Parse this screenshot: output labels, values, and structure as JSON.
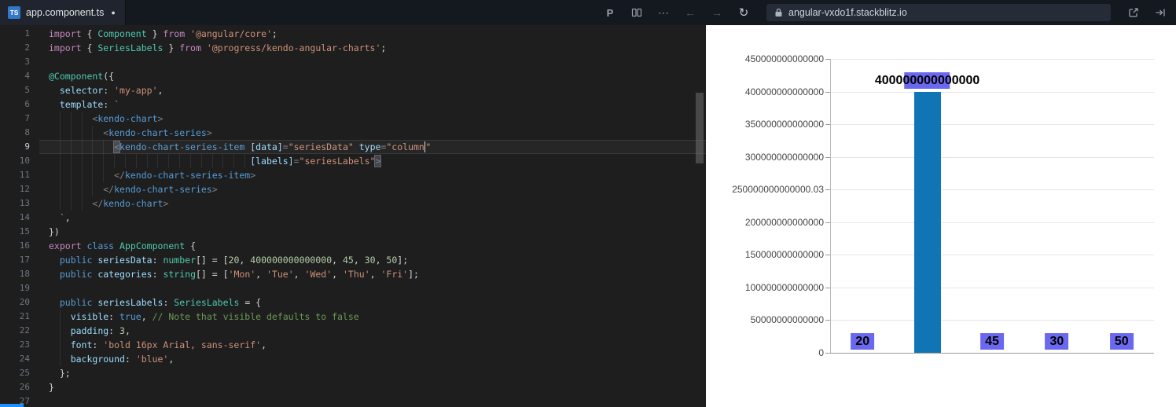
{
  "topbar": {
    "tab": {
      "icon_text": "TS",
      "label": "app.component.ts",
      "modified_dot": "●"
    },
    "actions": {
      "prettier": "P",
      "more": "⋯",
      "back": "←",
      "forward": "→",
      "refresh": "↻"
    },
    "url": "angular-vxdo1f.stackblitz.io"
  },
  "editor": {
    "active_line": 9,
    "lines": [
      {
        "n": 1,
        "segs": [
          [
            "kw",
            "import"
          ],
          [
            "d",
            " { "
          ],
          [
            "ty",
            "Component"
          ],
          [
            "d",
            " } "
          ],
          [
            "kw",
            "from"
          ],
          [
            "d",
            " "
          ],
          [
            "st",
            "'@angular/core'"
          ],
          [
            "d",
            ";"
          ]
        ]
      },
      {
        "n": 2,
        "segs": [
          [
            "kw",
            "import"
          ],
          [
            "d",
            " { "
          ],
          [
            "ty",
            "SeriesLabels"
          ],
          [
            "d",
            " } "
          ],
          [
            "kw",
            "from"
          ],
          [
            "d",
            " "
          ],
          [
            "st",
            "'@progress/kendo-angular-charts'"
          ],
          [
            "d",
            ";"
          ]
        ]
      },
      {
        "n": 3,
        "segs": []
      },
      {
        "n": 4,
        "segs": [
          [
            "ty",
            "@Component"
          ],
          [
            "d",
            "({"
          ]
        ]
      },
      {
        "n": 5,
        "segs": [
          [
            "d",
            "  "
          ],
          [
            "pr",
            "selector"
          ],
          [
            "d",
            ": "
          ],
          [
            "st",
            "'my-app'"
          ],
          [
            "d",
            ","
          ]
        ]
      },
      {
        "n": 6,
        "segs": [
          [
            "d",
            "  "
          ],
          [
            "pr",
            "template"
          ],
          [
            "d",
            ": "
          ],
          [
            "st",
            "`"
          ]
        ]
      },
      {
        "n": 7,
        "segs": [
          [
            "d",
            "        "
          ],
          [
            "pu",
            "<"
          ],
          [
            "tg",
            "kendo-chart"
          ],
          [
            "pu",
            ">"
          ]
        ]
      },
      {
        "n": 8,
        "segs": [
          [
            "d",
            "          "
          ],
          [
            "pu",
            "<"
          ],
          [
            "tg",
            "kendo-chart-series"
          ],
          [
            "pu",
            ">"
          ]
        ]
      },
      {
        "n": 9,
        "segs": [
          [
            "d",
            "            "
          ],
          [
            "pu bm",
            "<"
          ],
          [
            "tg",
            "kendo-chart-series-item"
          ],
          [
            "d",
            " "
          ],
          [
            "pr",
            "[data]"
          ],
          [
            "pu",
            "="
          ],
          [
            "st",
            "\"seriesData\""
          ],
          [
            "d",
            " "
          ],
          [
            "pr",
            "type"
          ],
          [
            "pu",
            "="
          ],
          [
            "st",
            "\"column"
          ],
          [
            "caret",
            ""
          ],
          [
            "st",
            "\""
          ]
        ]
      },
      {
        "n": 10,
        "segs": [
          [
            "d",
            "                                     "
          ],
          [
            "pr",
            "[labels]"
          ],
          [
            "pu",
            "="
          ],
          [
            "st",
            "\"seriesLabels\""
          ],
          [
            "pu bm",
            ">"
          ]
        ]
      },
      {
        "n": 11,
        "segs": [
          [
            "d",
            "            "
          ],
          [
            "pu",
            "</"
          ],
          [
            "tg",
            "kendo-chart-series-item"
          ],
          [
            "pu",
            ">"
          ]
        ]
      },
      {
        "n": 12,
        "segs": [
          [
            "d",
            "          "
          ],
          [
            "pu",
            "</"
          ],
          [
            "tg",
            "kendo-chart-series"
          ],
          [
            "pu",
            ">"
          ]
        ]
      },
      {
        "n": 13,
        "segs": [
          [
            "d",
            "        "
          ],
          [
            "pu",
            "</"
          ],
          [
            "tg",
            "kendo-chart"
          ],
          [
            "pu",
            ">"
          ]
        ]
      },
      {
        "n": 14,
        "segs": [
          [
            "d",
            "  "
          ],
          [
            "st",
            "`"
          ],
          [
            "d",
            ","
          ]
        ]
      },
      {
        "n": 15,
        "segs": [
          [
            "d",
            "})"
          ]
        ]
      },
      {
        "n": 16,
        "segs": [
          [
            "kw",
            "export"
          ],
          [
            "d",
            " "
          ],
          [
            "kb",
            "class"
          ],
          [
            "d",
            " "
          ],
          [
            "ty",
            "AppComponent"
          ],
          [
            "d",
            " {"
          ]
        ]
      },
      {
        "n": 17,
        "segs": [
          [
            "d",
            "  "
          ],
          [
            "kb",
            "public"
          ],
          [
            "d",
            " "
          ],
          [
            "pr",
            "seriesData"
          ],
          [
            "d",
            ": "
          ],
          [
            "ty",
            "number"
          ],
          [
            "d",
            "[] = ["
          ],
          [
            "nu",
            "20"
          ],
          [
            "d",
            ", "
          ],
          [
            "nu",
            "400000000000000"
          ],
          [
            "d",
            ", "
          ],
          [
            "nu",
            "45"
          ],
          [
            "d",
            ", "
          ],
          [
            "nu",
            "30"
          ],
          [
            "d",
            ", "
          ],
          [
            "nu",
            "50"
          ],
          [
            "d",
            "];"
          ]
        ]
      },
      {
        "n": 18,
        "segs": [
          [
            "d",
            "  "
          ],
          [
            "kb",
            "public"
          ],
          [
            "d",
            " "
          ],
          [
            "pr",
            "categories"
          ],
          [
            "d",
            ": "
          ],
          [
            "ty",
            "string"
          ],
          [
            "d",
            "[] = ["
          ],
          [
            "st",
            "'Mon'"
          ],
          [
            "d",
            ", "
          ],
          [
            "st",
            "'Tue'"
          ],
          [
            "d",
            ", "
          ],
          [
            "st",
            "'Wed'"
          ],
          [
            "d",
            ", "
          ],
          [
            "st",
            "'Thu'"
          ],
          [
            "d",
            ", "
          ],
          [
            "st",
            "'Fri'"
          ],
          [
            "d",
            "];"
          ]
        ]
      },
      {
        "n": 19,
        "segs": []
      },
      {
        "n": 20,
        "segs": [
          [
            "d",
            "  "
          ],
          [
            "kb",
            "public"
          ],
          [
            "d",
            " "
          ],
          [
            "pr",
            "seriesLabels"
          ],
          [
            "d",
            ": "
          ],
          [
            "ty",
            "SeriesLabels"
          ],
          [
            "d",
            " = {"
          ]
        ]
      },
      {
        "n": 21,
        "segs": [
          [
            "d",
            "    "
          ],
          [
            "pr",
            "visible"
          ],
          [
            "d",
            ": "
          ],
          [
            "kb",
            "true"
          ],
          [
            "d",
            ", "
          ],
          [
            "cm",
            "// Note that visible defaults to false"
          ]
        ]
      },
      {
        "n": 22,
        "segs": [
          [
            "d",
            "    "
          ],
          [
            "pr",
            "padding"
          ],
          [
            "d",
            ": "
          ],
          [
            "nu",
            "3"
          ],
          [
            "d",
            ","
          ]
        ]
      },
      {
        "n": 23,
        "segs": [
          [
            "d",
            "    "
          ],
          [
            "pr",
            "font"
          ],
          [
            "d",
            ": "
          ],
          [
            "st",
            "'bold 16px Arial, sans-serif'"
          ],
          [
            "d",
            ","
          ]
        ]
      },
      {
        "n": 24,
        "segs": [
          [
            "d",
            "    "
          ],
          [
            "pr",
            "background"
          ],
          [
            "d",
            ": "
          ],
          [
            "st",
            "'blue'"
          ],
          [
            "d",
            ","
          ]
        ]
      },
      {
        "n": 25,
        "segs": [
          [
            "d",
            "  };"
          ]
        ]
      },
      {
        "n": 26,
        "segs": [
          [
            "d",
            "}"
          ]
        ]
      },
      {
        "n": 27,
        "segs": []
      }
    ]
  },
  "chart_data": {
    "type": "bar",
    "title": "",
    "values": [
      20,
      400000000000000,
      45,
      30,
      50
    ],
    "bar_labels": [
      "20",
      "400000000000000",
      "45",
      "30",
      "50"
    ],
    "x_axis_labels": [],
    "ylim": [
      0,
      450000000000000
    ],
    "ytick_values": [
      450000000000000,
      400000000000000,
      350000000000000,
      300000000000000,
      250000000000000.03,
      200000000000000,
      150000000000000,
      100000000000000,
      50000000000000,
      0
    ],
    "ytick_labels": [
      "450000000000000",
      "400000000000000",
      "350000000000000",
      "300000000000000",
      "250000000000000.03",
      "200000000000000",
      "150000000000000",
      "100000000000000",
      "50000000000000",
      "0"
    ],
    "series_color": "#1175b5",
    "label_background": "#6b68f0",
    "label_text_color": "#000000",
    "grid": true,
    "legend": false
  }
}
